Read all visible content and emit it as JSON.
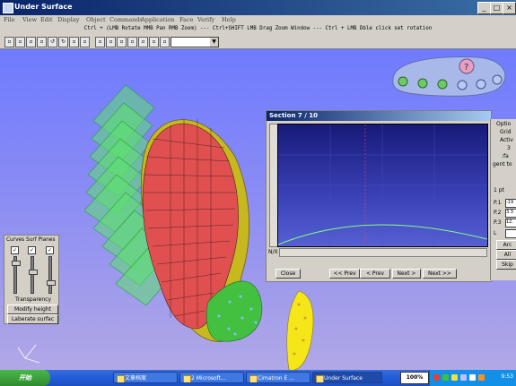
{
  "window": {
    "title": "Under Surface"
  },
  "menu": [
    "File",
    "View",
    "Edit",
    "Display",
    "Object",
    "Commands",
    "Application",
    "Face",
    "Verify",
    "Help"
  ],
  "hint": "Ctrl + (LMB Rotate MMB Pan RMB Zoom) --- Ctrl+SHIFT LMB Drag  Zoom Window  --- Ctrl + LMB Dble click set rotation",
  "floating_panel": {
    "icons": [
      "help-icon",
      "rotate-icon",
      "pan-icon",
      "zoom-icon",
      "layers-icon",
      "settings-icon",
      "save-icon"
    ]
  },
  "section_dialog": {
    "title": "Section 7 / 10",
    "axis_label": "N/X",
    "buttons": {
      "close": "Close",
      "prev2": "<< Prev",
      "prev": "< Prev",
      "next": "Next >",
      "next2": "Next >>"
    }
  },
  "options_panel": {
    "lines": [
      "Optio",
      "Grid",
      "Activ",
      "3",
      ":fa",
      "gent to"
    ],
    "radio_label": "1 pt",
    "point_labels": [
      "P.1",
      "P.2",
      "P.3",
      "L"
    ],
    "point_values": [
      "-19",
      "3.3",
      "12.",
      ""
    ],
    "buttons": [
      "Arc",
      "All",
      "Skip"
    ]
  },
  "curves_panel": {
    "header": "Curves Surf Planes",
    "checks": [
      "✓",
      "✓",
      "✓"
    ],
    "transparency_label": "Transparency",
    "buttons": [
      "Modify height",
      "Laberate surfac"
    ]
  },
  "taskbar": {
    "start_label": "开始",
    "tasks": [
      "文章档案",
      "2 Microsoft...",
      "Cimatron E ...",
      "Under Surface"
    ],
    "zoom": "100%",
    "clock": "9:53"
  },
  "colors": {
    "titlebar": "#0a246a",
    "viewport_top": "#6f7bff",
    "section_plot": "#171a78",
    "curve": "#80ff80"
  }
}
